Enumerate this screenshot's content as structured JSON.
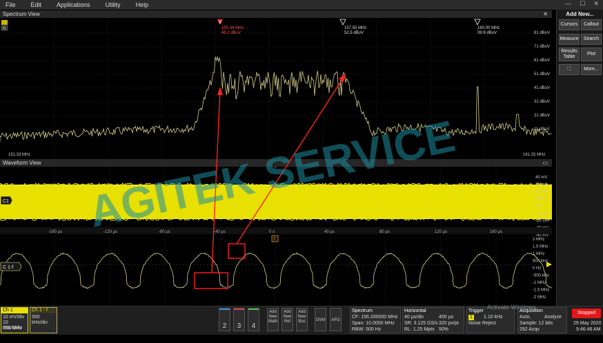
{
  "menu": [
    "File",
    "Edit",
    "Applications",
    "Utility",
    "Help"
  ],
  "spectrum_view": {
    "title": "Spectrum View",
    "y_labels": [
      "81 dBuV",
      "71 dBuV",
      "61 dBuV",
      "51 dBuV",
      "41 dBuV",
      "31 dBuV",
      "21 dBuV",
      "11 dBuV"
    ],
    "start_freq": "151.33 MHz",
    "stop_freq": "161.33 MHz",
    "markers": [
      {
        "freq": "155.34 MHz",
        "level": "66.2 dBuV",
        "color": "#ff3030"
      },
      {
        "freq": "157.55 MHz",
        "level": "52.5 dBuV",
        "color": "#ffffff"
      },
      {
        "freq": "160.00 MHz",
        "level": "39.9 dBuV",
        "color": "#ffffff"
      }
    ]
  },
  "waveform_view": {
    "title": "Waveform View",
    "ch1_label": "C1",
    "ch1_f_label": "C 1-f",
    "ch1_y_labels": [
      "40 mV",
      "30 mV",
      "20 mV",
      "10 mV",
      "0 V",
      "-10 mV",
      "-20 mV",
      "-30 mV",
      "-40 mV"
    ],
    "time_labels": [
      "-160 µs",
      "-120 µs",
      "-80 µs",
      "-40 µs",
      "0 s",
      "40 µs",
      "80 µs",
      "120 µs",
      "160 µs"
    ],
    "freq_y_labels": [
      "2 MHz",
      "1.5 MHz",
      "1 MHz",
      "500 kHz",
      "0 Hz",
      "-500 kHz",
      "-1 MHz",
      "-1.5 MHz",
      "-2 MHz"
    ],
    "trigger_marker": "T"
  },
  "watermark": "AGITEK SERVICE",
  "right_panel": {
    "title": "Add New...",
    "buttons": [
      "Cursors",
      "Callout",
      "Measure",
      "Search",
      "Results Table",
      "Plot",
      "",
      "More..."
    ]
  },
  "bottom": {
    "ch1": {
      "title": "Ch 1",
      "lines": [
        "10 mV/div",
        "10 dBuV/div",
        "500 MHz"
      ]
    },
    "ch1f": {
      "title": "Ch 1 - f",
      "lines": [
        "500 kHz/div"
      ]
    },
    "channels": [
      "2",
      "3",
      "4"
    ],
    "add_buttons": [
      "Add New Math",
      "Add New Ref",
      "Add New Bus"
    ],
    "dvm": "DVM",
    "afg": "AFG",
    "spectrum": {
      "title": "Spectrum",
      "lines": [
        "CF: 156.330000 MHz",
        "Span: 10.0000 MHz",
        "RBW: 500 Hz"
      ]
    },
    "horizontal": {
      "title": "Horizontal",
      "col1": [
        "40 µs/div",
        "SR: 3.125 GS/s",
        "RL: 1.25 Mpts"
      ],
      "col2": [
        "400 µs",
        "320 ps/pt",
        "50%"
      ]
    },
    "trigger": {
      "title": "Trigger",
      "lines": [
        "1",
        "1.10 kHz",
        "Noise Reject"
      ]
    },
    "acquisition": {
      "title": "Acquisition",
      "lines": [
        "Auto,",
        "Analyze",
        "Sample: 12 bits",
        "292 Acqs"
      ]
    },
    "activate_text": "Activate Windows",
    "stopped": "Stopped",
    "date": "29 May 2020",
    "time": "9:46:46 AM"
  }
}
